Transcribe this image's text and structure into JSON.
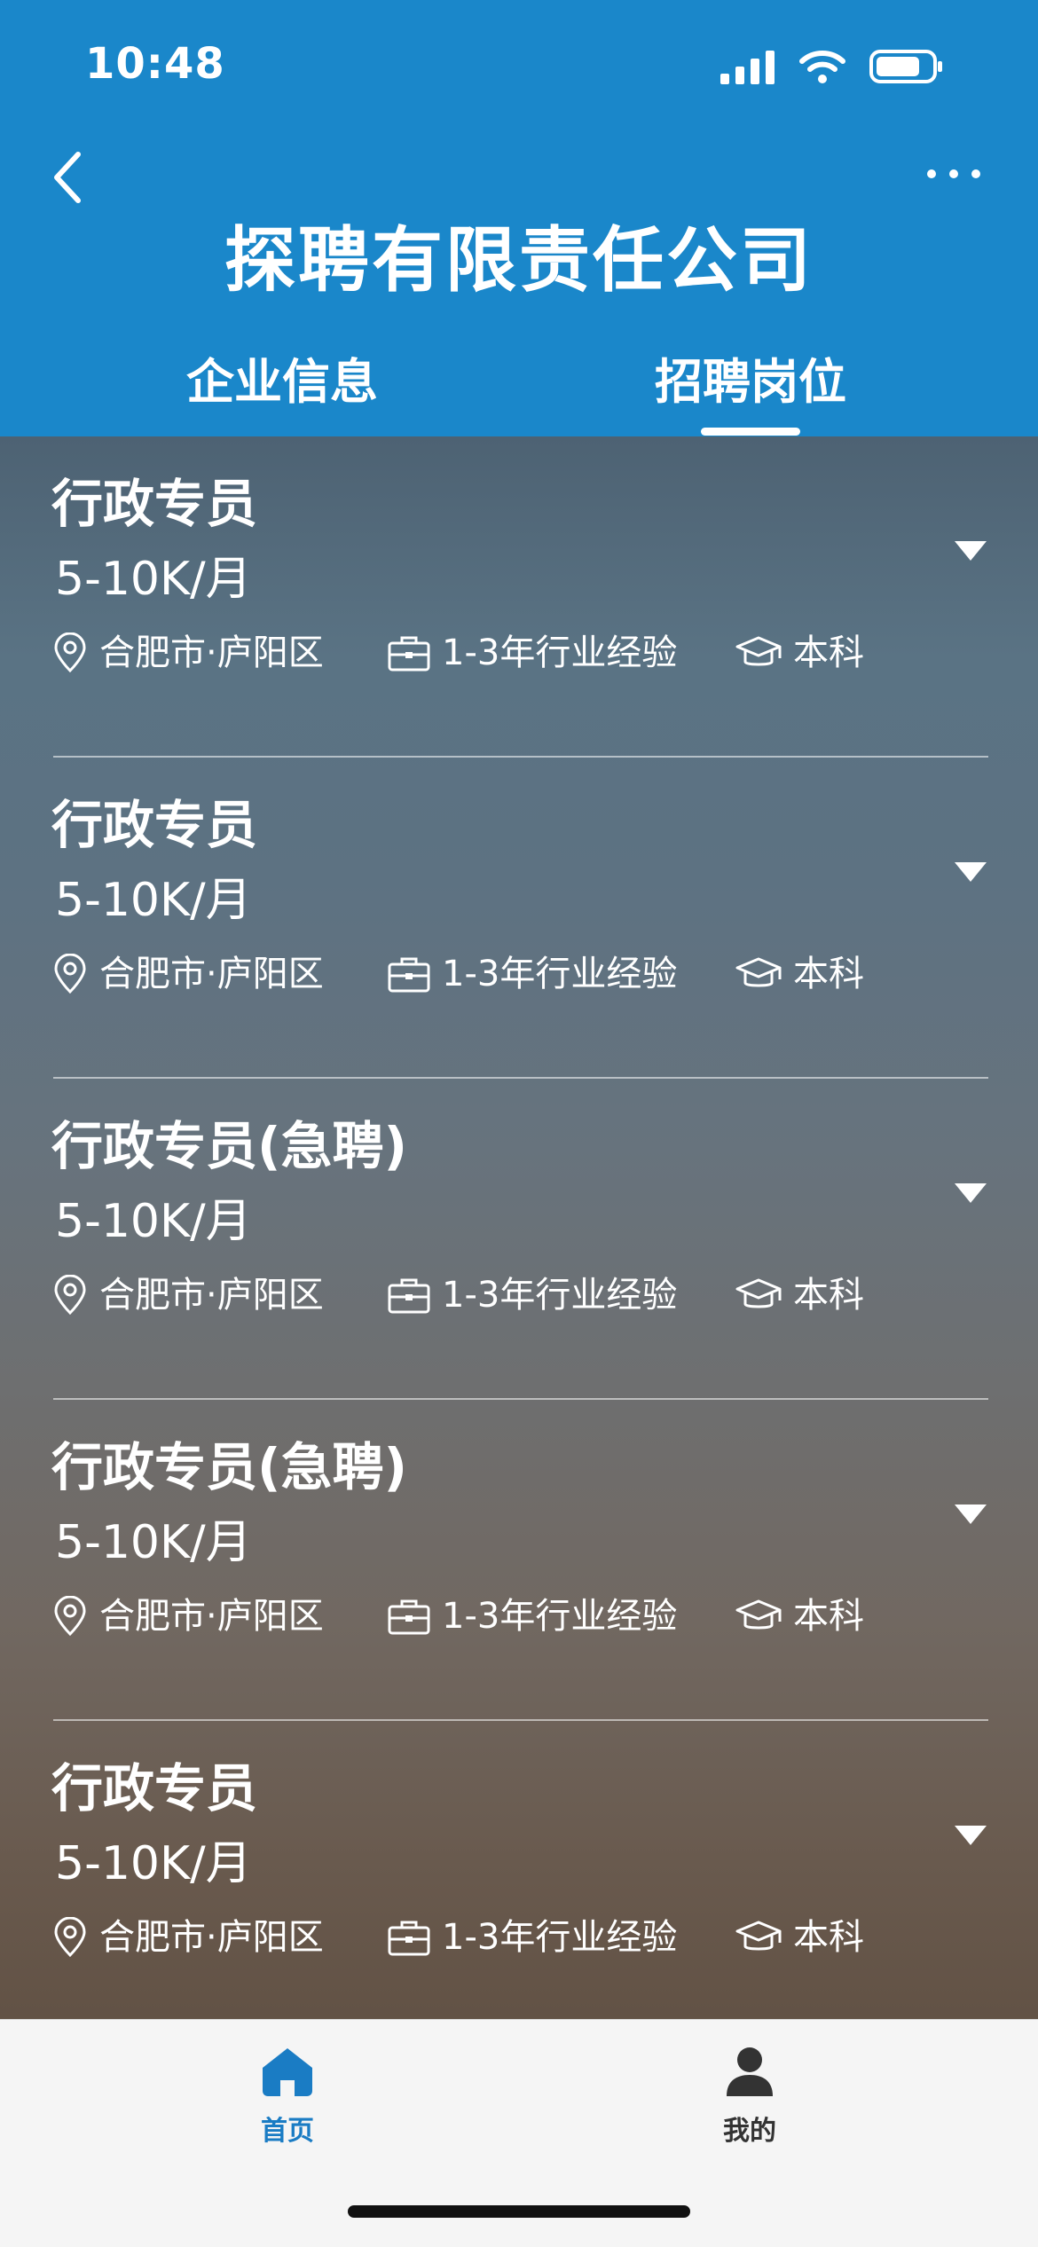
{
  "status_bar": {
    "time": "10:48"
  },
  "header": {
    "title": "探聘有限责任公司",
    "tabs": [
      {
        "label": "企业信息",
        "active": false
      },
      {
        "label": "招聘岗位",
        "active": true
      }
    ]
  },
  "jobs": [
    {
      "title": "行政专员",
      "salary": "5-10K/月",
      "location": "合肥市·庐阳区",
      "experience": "1-3年行业经验",
      "education": "本科"
    },
    {
      "title": "行政专员",
      "salary": "5-10K/月",
      "location": "合肥市·庐阳区",
      "experience": "1-3年行业经验",
      "education": "本科"
    },
    {
      "title": "行政专员(急聘)",
      "salary": "5-10K/月",
      "location": "合肥市·庐阳区",
      "experience": "1-3年行业经验",
      "education": "本科"
    },
    {
      "title": "行政专员(急聘)",
      "salary": "5-10K/月",
      "location": "合肥市·庐阳区",
      "experience": "1-3年行业经验",
      "education": "本科"
    },
    {
      "title": "行政专员",
      "salary": "5-10K/月",
      "location": "合肥市·庐阳区",
      "experience": "1-3年行业经验",
      "education": "本科"
    }
  ],
  "tabbar": {
    "items": [
      {
        "label": "首页",
        "icon": "home-icon",
        "active": true
      },
      {
        "label": "我的",
        "icon": "user-icon",
        "active": false
      }
    ]
  },
  "colors": {
    "header_bg": "#1a87ca",
    "active_tab_label": "#1a7cc4",
    "tabbar_bg": "#f5f5f5"
  }
}
